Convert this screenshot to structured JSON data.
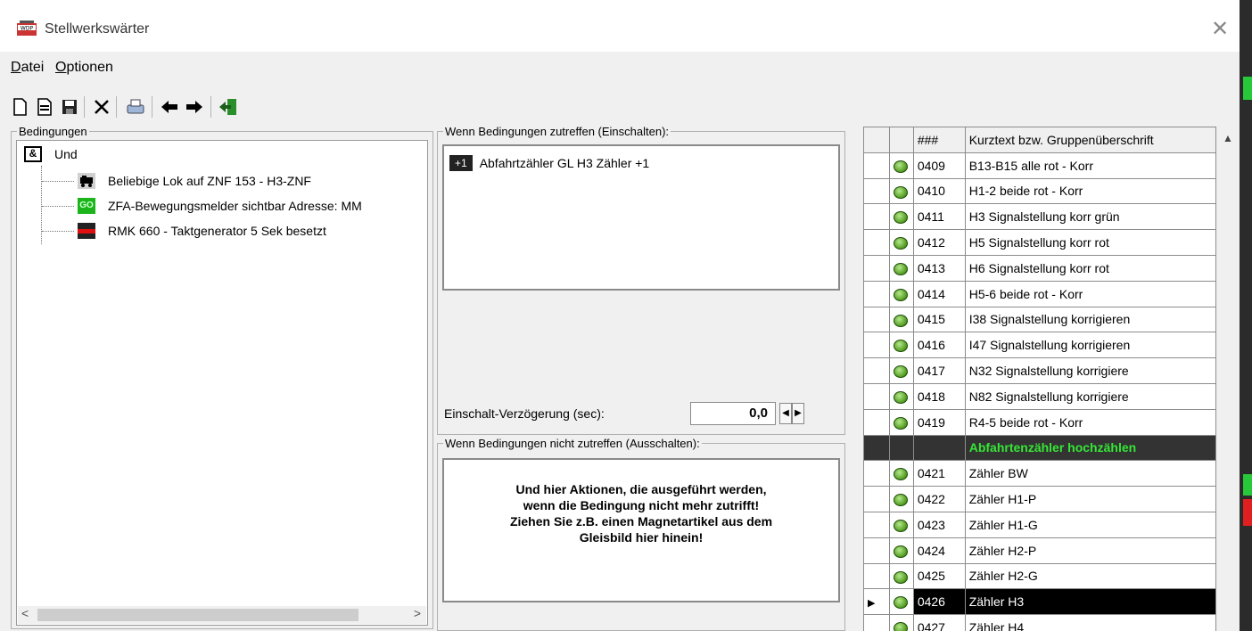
{
  "window": {
    "title": "Stellwerkswärter"
  },
  "menu": [
    {
      "accel": "D",
      "rest": "atei"
    },
    {
      "accel": "O",
      "rest": "ptionen"
    }
  ],
  "toolbar": [
    "new-icon",
    "open-icon",
    "save-icon",
    "delete-icon",
    "print-icon",
    "back-arrow-icon",
    "forward-arrow-icon",
    "exit-icon"
  ],
  "conditions": {
    "legend": "Bedingungen",
    "root_label": "Und",
    "root_icon_text": "&",
    "items": [
      {
        "label": "Beliebige Lok auf ZNF 153 - H3-ZNF",
        "icon": "locomotive-icon"
      },
      {
        "label": "ZFA-Bewegungsmelder sichtbar Adresse: MM",
        "icon": "go-signal-icon",
        "icon_text": "GO"
      },
      {
        "label": "RMK 660 - Taktgenerator 5 Sek besetzt",
        "icon": "track-occupied-icon"
      }
    ]
  },
  "on_true": {
    "legend": "Wenn Bedingungen zutreffen (Einschalten):",
    "actions": [
      {
        "badge": "+1",
        "label": "Abfahrtzähler GL H3 Zähler +1"
      }
    ],
    "delay_label": "Einschalt-Verzögerung (sec):",
    "delay_value": "0,0"
  },
  "on_false": {
    "legend": "Wenn Bedingungen nicht zutreffen (Ausschalten):",
    "hint": "Und hier Aktionen, die ausgeführt werden,\nwenn die Bedingung nicht mehr zutrifft!\nZiehen Sie z.B. einen Magnetartikel aus dem\nGleisbild hier hinein!"
  },
  "grid": {
    "col_num": "###",
    "col_text": "Kurztext bzw. Gruppenüberschrift",
    "rows": [
      {
        "num": "0409",
        "text": "B13-B15 alle rot - Korr",
        "type": "item"
      },
      {
        "num": "0410",
        "text": "H1-2 beide rot - Korr",
        "type": "item"
      },
      {
        "num": "0411",
        "text": "H3 Signalstellung korr grün",
        "type": "item"
      },
      {
        "num": "0412",
        "text": "H5 Signalstellung korr rot",
        "type": "item"
      },
      {
        "num": "0413",
        "text": "H6 Signalstellung korr rot",
        "type": "item"
      },
      {
        "num": "0414",
        "text": "H5-6 beide rot - Korr",
        "type": "item"
      },
      {
        "num": "0415",
        "text": "I38 Signalstellung korrigieren",
        "type": "item"
      },
      {
        "num": "0416",
        "text": "I47 Signalstellung korrigieren",
        "type": "item"
      },
      {
        "num": "0417",
        "text": "N32 Signalstellung korrigiere",
        "type": "item"
      },
      {
        "num": "0418",
        "text": "N82 Signalstellung korrigiere",
        "type": "item"
      },
      {
        "num": "0419",
        "text": "R4-5 beide rot - Korr",
        "type": "item"
      },
      {
        "num": "",
        "text": "Abfahrtenzähler hochzählen",
        "type": "group"
      },
      {
        "num": "0421",
        "text": "Zähler BW",
        "type": "item"
      },
      {
        "num": "0422",
        "text": "Zähler H1-P",
        "type": "item"
      },
      {
        "num": "0423",
        "text": "Zähler H1-G",
        "type": "item"
      },
      {
        "num": "0424",
        "text": "Zähler H2-P",
        "type": "item"
      },
      {
        "num": "0425",
        "text": "Zähler H2-G",
        "type": "item"
      },
      {
        "num": "0426",
        "text": "Zähler H3",
        "type": "selected"
      },
      {
        "num": "0427",
        "text": "Zähler H4",
        "type": "item"
      }
    ]
  }
}
